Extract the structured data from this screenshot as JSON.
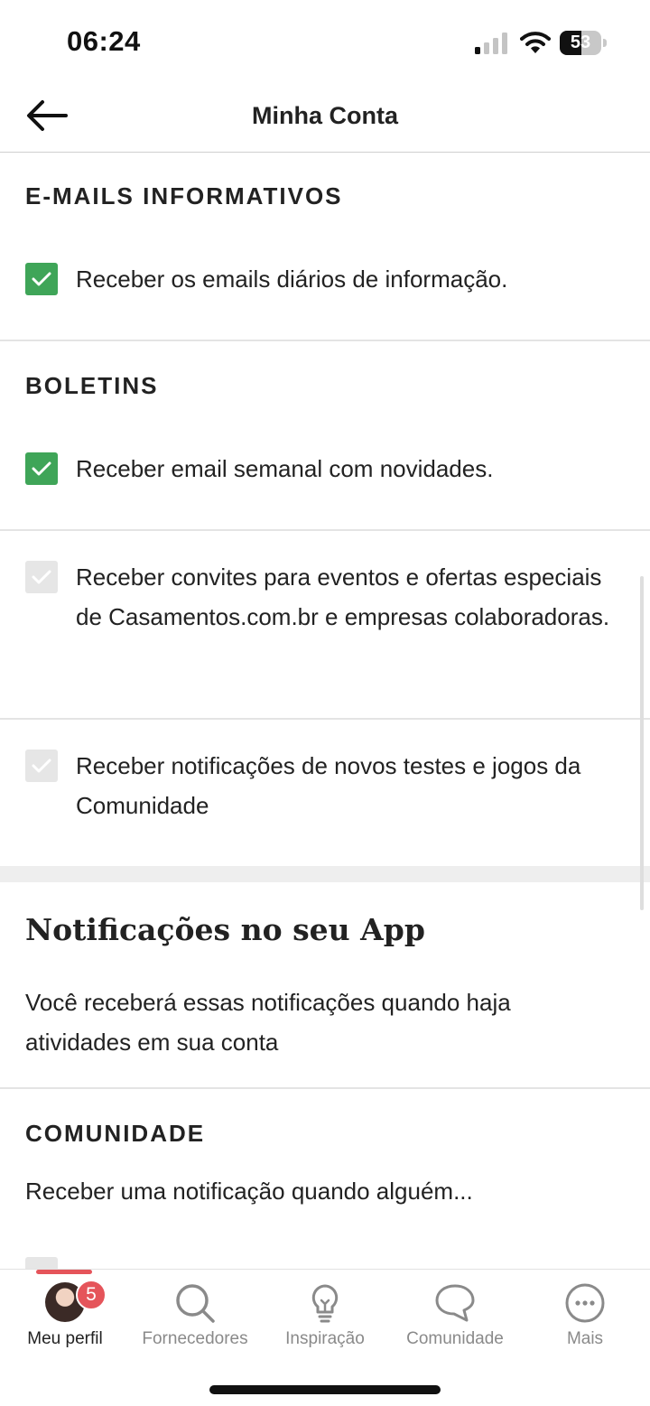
{
  "status_bar": {
    "time": "06:24",
    "battery": "53",
    "battery_level_percent": 53,
    "icons": [
      "signal-icon",
      "wifi-icon",
      "battery-icon"
    ]
  },
  "header": {
    "title": "Minha Conta",
    "back_icon": "arrow-left-icon"
  },
  "sections": {
    "informativos": {
      "heading": "E-MAILS INFORMATIVOS",
      "items": [
        {
          "label": "Receber os emails diários de informação.",
          "checked": true
        }
      ]
    },
    "boletins": {
      "heading": "BOLETINS",
      "items": [
        {
          "label": "Receber email semanal com novidades.",
          "checked": true
        },
        {
          "label": "Receber convites para eventos e ofertas especiais de Casamentos.com.br e empresas colaboradoras.",
          "checked": false
        },
        {
          "label": "Receber notificações de novos testes e jogos da Comunidade",
          "checked": false
        }
      ]
    },
    "app_notifications": {
      "title": "Notificações no seu App",
      "description": "Você receberá essas notificações quando haja atividades em sua conta"
    },
    "comunidade": {
      "heading": "COMUNIDADE",
      "description": "Receber uma notificação quando alguém..."
    }
  },
  "colors": {
    "checked": "#3fa558",
    "unchecked": "#e6e6e6",
    "accent": "#e5545a"
  },
  "bottom_nav": {
    "items": [
      {
        "label": "Meu perfil",
        "icon": "avatar",
        "active": true,
        "badge": "5"
      },
      {
        "label": "Fornecedores",
        "icon": "search-icon",
        "active": false
      },
      {
        "label": "Inspiração",
        "icon": "lightbulb-icon",
        "active": false
      },
      {
        "label": "Comunidade",
        "icon": "chat-bubble-icon",
        "active": false
      },
      {
        "label": "Mais",
        "icon": "more-icon",
        "active": false
      }
    ]
  }
}
